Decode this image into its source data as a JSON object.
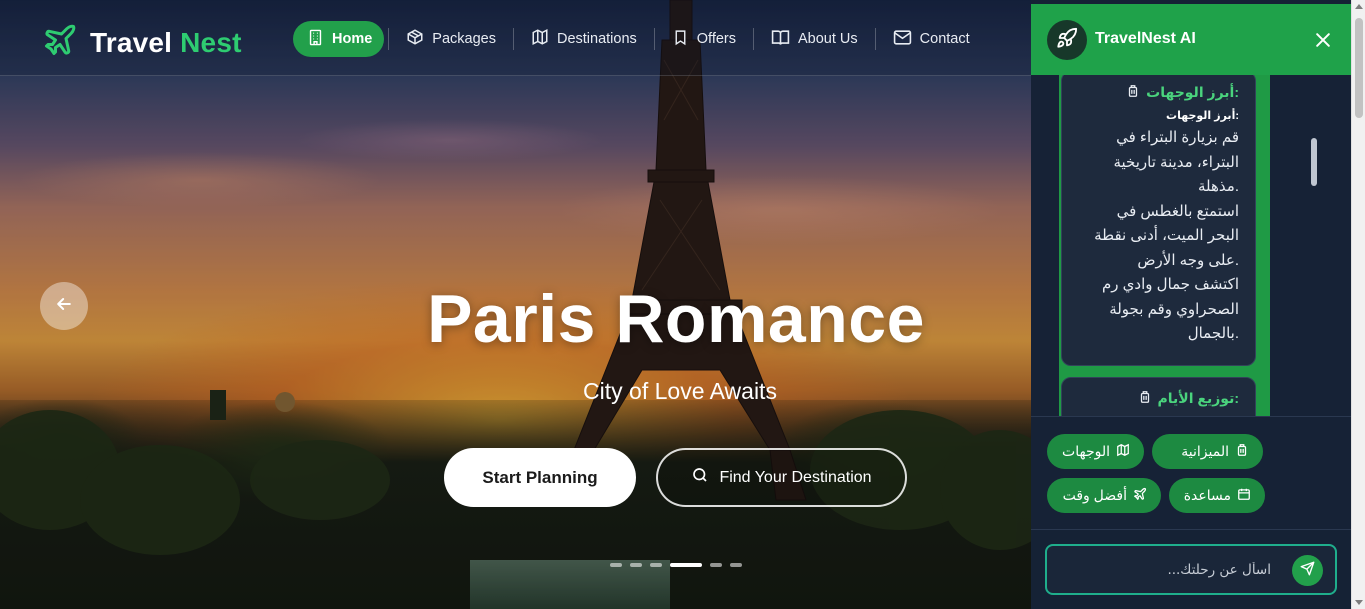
{
  "brand": {
    "name_part1": "Travel",
    "name_part2": "Nest",
    "logo_icon": "plane-icon",
    "accent_color": "#2ecc71"
  },
  "nav": {
    "items": [
      {
        "label": "Home",
        "icon": "building-icon",
        "active": true
      },
      {
        "label": "Packages",
        "icon": "package-icon",
        "active": false
      },
      {
        "label": "Destinations",
        "icon": "map-icon",
        "active": false
      },
      {
        "label": "Offers",
        "icon": "bookmark-icon",
        "active": false
      },
      {
        "label": "About Us",
        "icon": "book-open-icon",
        "active": false
      },
      {
        "label": "Contact",
        "icon": "mail-icon",
        "active": false
      }
    ]
  },
  "hero": {
    "title": "Paris Romance",
    "subtitle": "City of Love Awaits",
    "primary_button": "Start Planning",
    "secondary_button": "Find Your Destination",
    "prev_icon": "arrow-left-icon",
    "slides_count": 6,
    "active_slide": 4
  },
  "chat": {
    "title": "TravelNest AI",
    "header_color": "#1fa24a",
    "messages": [
      {
        "heading": ":أبرز الوجهات",
        "subheading": ":أبرز الوجهات",
        "lines": [
          "قم بزيارة البتراء في",
          "البتراء، مدينة تاريخية",
          ".مذهلة",
          "استمتع بالغطس في",
          "البحر الميت، أدنى نقطة",
          ".على وجه الأرض",
          "اكتشف جمال وادي رم",
          "الصحراوي وقم بجولة",
          ".بالجمال"
        ]
      },
      {
        "heading": ":توزيع الأيام"
      }
    ],
    "quick_replies": [
      {
        "label": "الميزانية",
        "icon": "wallet-icon"
      },
      {
        "label": "الوجهات",
        "icon": "map-icon"
      },
      {
        "label": "مساعدة",
        "icon": "calendar-icon"
      },
      {
        "label": "أفضل وقت",
        "icon": "plane-icon"
      }
    ],
    "input": {
      "value": "",
      "placeholder": "اسأل عن رحلتك..."
    }
  }
}
